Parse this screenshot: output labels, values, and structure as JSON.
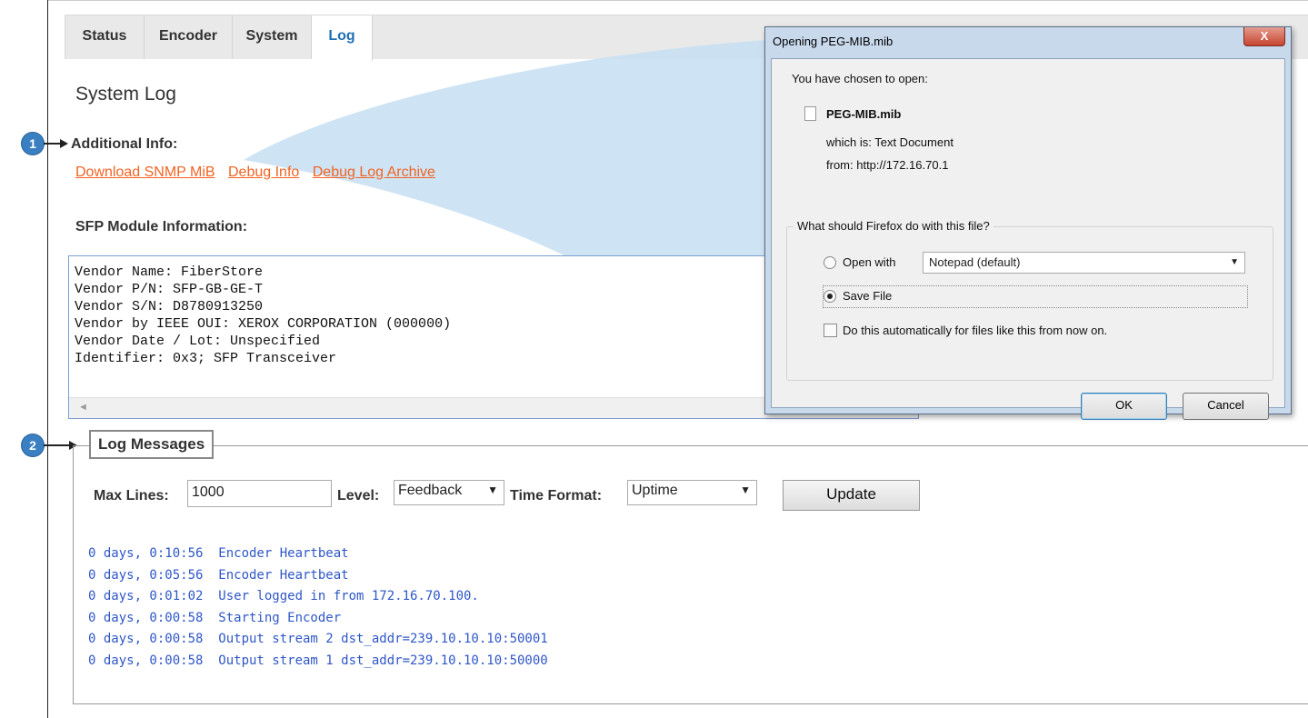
{
  "tabs": [
    {
      "label": "Status"
    },
    {
      "label": "Encoder"
    },
    {
      "label": "System"
    },
    {
      "label": "Log",
      "active": true
    }
  ],
  "page_title": "System Log",
  "markers": [
    "1",
    "2"
  ],
  "additional_info": {
    "heading": "Additional Info:",
    "links": [
      "Download SNMP MiB",
      "Debug Info",
      "Debug Log Archive"
    ]
  },
  "sfp": {
    "heading": "SFP Module Information:",
    "lines": [
      "Vendor Name: FiberStore",
      "Vendor P/N: SFP-GB-GE-T",
      "Vendor S/N: D8780913250",
      "Vendor by IEEE OUI: XEROX CORPORATION (000000)",
      "Vendor Date / Lot: Unspecified",
      "Identifier: 0x3; SFP Transceiver"
    ]
  },
  "log": {
    "legend": "Log Messages",
    "max_lines_label": "Max Lines:",
    "max_lines_value": "1000",
    "level_label": "Level:",
    "level_value": "Feedback",
    "time_format_label": "Time Format:",
    "time_format_value": "Uptime",
    "update_label": "Update",
    "entries": [
      "0 days, 0:10:56  Encoder Heartbeat",
      "0 days, 0:05:56  Encoder Heartbeat",
      "0 days, 0:01:02  User logged in from 172.16.70.100.",
      "0 days, 0:00:58  Starting Encoder",
      "0 days, 0:00:58  Output stream 2 dst_addr=239.10.10.10:50001",
      "0 days, 0:00:58  Output stream 1 dst_addr=239.10.10.10:50000"
    ]
  },
  "dialog": {
    "title": "Opening PEG-MIB.mib",
    "close_label": "X",
    "intro": "You have chosen to open:",
    "file_name": "PEG-MIB.mib",
    "which_is": "which is: Text Document",
    "from": "from: http://172.16.70.1",
    "question": "What should Firefox do with this file?",
    "open_with_label": "Open with",
    "open_with_app": "Notepad (default)",
    "save_file_label": "Save File",
    "auto_label": "Do this automatically for files like this from now on.",
    "ok_label": "OK",
    "cancel_label": "Cancel",
    "selected_option": "save"
  },
  "colors": {
    "link": "#f26322",
    "active_tab": "#1f6fb5",
    "log_text": "#2f57c8",
    "marker": "#3a7fc1",
    "callout": "#c5dff2"
  },
  "icons": {
    "select_caret": "▼",
    "scroll_left": "◄"
  }
}
